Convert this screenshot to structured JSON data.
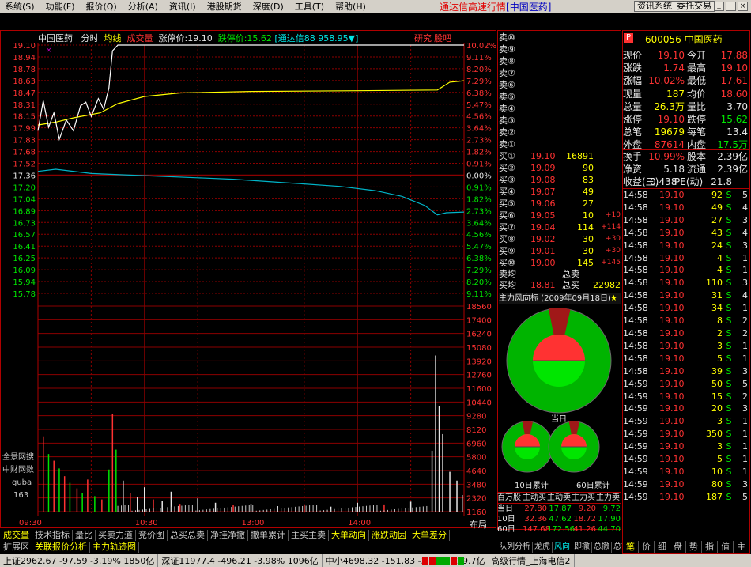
{
  "menu": [
    "系统(S)",
    "功能(F)",
    "报价(Q)",
    "分析(A)",
    "资讯(I)",
    "港股期货",
    "深度(D)",
    "工具(T)",
    "帮助(H)"
  ],
  "title": {
    "main": "通达信高速行情",
    "stock": "[中国医药]"
  },
  "right_buttons": [
    "资讯系统",
    "委托交易"
  ],
  "chart_header": {
    "name": "中国医药",
    "mode": "分时",
    "avg_label": "均线",
    "vol_label": "成交量",
    "limit_up": "涨停价:19.10",
    "limit_down": "跌停价:15.62",
    "tdx": "[通达信88 958.95▼]",
    "research": "研究",
    "guba": "股吧"
  },
  "side_labels": [
    "全景网搜",
    "中财网数",
    "guba",
    "163"
  ],
  "chart_data": {
    "type": "line",
    "price_ticks": [
      "19.10",
      "18.94",
      "18.78",
      "18.63",
      "18.47",
      "18.31",
      "18.15",
      "17.99",
      "17.83",
      "17.68",
      "17.52",
      "17.36",
      "17.20",
      "17.04",
      "16.89",
      "16.73",
      "16.57",
      "16.41",
      "16.25",
      "16.09",
      "15.94",
      "15.78"
    ],
    "pct_ticks": [
      "10.02%",
      "9.11%",
      "8.20%",
      "7.29%",
      "6.38%",
      "5.47%",
      "4.56%",
      "3.64%",
      "2.73%",
      "1.82%",
      "0.91%",
      "0.00%",
      "0.91%",
      "1.82%",
      "2.73%",
      "3.64%",
      "4.56%",
      "5.47%",
      "6.38%",
      "7.29%",
      "8.20%",
      "9.11%"
    ],
    "vol_ticks": [
      "18560",
      "17400",
      "16240",
      "15080",
      "13920",
      "12760",
      "11600",
      "10440",
      "9280",
      "8120",
      "6960",
      "5800",
      "4640",
      "3480",
      "2320",
      "1160"
    ],
    "time_labels": [
      "09:30",
      "10:30",
      "13:00",
      "14:00"
    ],
    "prev_close": 17.36,
    "ylim": [
      15.62,
      19.1
    ],
    "price": [
      {
        "t": 0,
        "v": 17.9
      },
      {
        "t": 3,
        "v": 18.32
      },
      {
        "t": 6,
        "v": 17.95
      },
      {
        "t": 9,
        "v": 18.15
      },
      {
        "t": 12,
        "v": 17.78
      },
      {
        "t": 16,
        "v": 18.05
      },
      {
        "t": 20,
        "v": 17.9
      },
      {
        "t": 24,
        "v": 18.25
      },
      {
        "t": 27,
        "v": 18.3
      },
      {
        "t": 30,
        "v": 18.1
      },
      {
        "t": 34,
        "v": 18.35
      },
      {
        "t": 37,
        "v": 18.2
      },
      {
        "t": 40,
        "v": 18.5
      },
      {
        "t": 42,
        "v": 19.02
      },
      {
        "t": 45,
        "v": 19.1
      },
      {
        "t": 240,
        "v": 19.1
      }
    ],
    "avg": [
      {
        "t": 0,
        "v": 17.98
      },
      {
        "t": 10,
        "v": 18.02
      },
      {
        "t": 20,
        "v": 18.08
      },
      {
        "t": 35,
        "v": 18.15
      },
      {
        "t": 45,
        "v": 18.28
      },
      {
        "t": 60,
        "v": 18.38
      },
      {
        "t": 80,
        "v": 18.43
      },
      {
        "t": 120,
        "v": 18.45
      },
      {
        "t": 180,
        "v": 18.46
      },
      {
        "t": 225,
        "v": 18.47
      },
      {
        "t": 232,
        "v": 18.58
      },
      {
        "t": 240,
        "v": 18.6
      }
    ],
    "index": [
      {
        "t": 0,
        "v": 17.33
      },
      {
        "t": 10,
        "v": 17.36
      },
      {
        "t": 30,
        "v": 17.3
      },
      {
        "t": 60,
        "v": 17.27
      },
      {
        "t": 90,
        "v": 17.24
      },
      {
        "t": 110,
        "v": 17.22
      },
      {
        "t": 140,
        "v": 17.17
      },
      {
        "t": 170,
        "v": 17.12
      },
      {
        "t": 190,
        "v": 17.06
      },
      {
        "t": 205,
        "v": 16.98
      },
      {
        "t": 218,
        "v": 16.85
      },
      {
        "t": 225,
        "v": 16.72
      },
      {
        "t": 230,
        "v": 16.75
      },
      {
        "t": 240,
        "v": 16.76
      }
    ],
    "volume": [
      {
        "t": 3,
        "v": 6800
      },
      {
        "t": 6,
        "v": 5200
      },
      {
        "t": 9,
        "v": 4600
      },
      {
        "t": 12,
        "v": 3900
      },
      {
        "t": 15,
        "v": 3200
      },
      {
        "t": 18,
        "v": 2600
      },
      {
        "t": 22,
        "v": 2100
      },
      {
        "t": 25,
        "v": 1700
      },
      {
        "t": 28,
        "v": 2900
      },
      {
        "t": 32,
        "v": 1400
      },
      {
        "t": 36,
        "v": 1100
      },
      {
        "t": 40,
        "v": 3800
      },
      {
        "t": 42,
        "v": 8800
      },
      {
        "t": 44,
        "v": 5600
      },
      {
        "t": 48,
        "v": 2800
      },
      {
        "t": 52,
        "v": 1700
      },
      {
        "t": 56,
        "v": 1300
      },
      {
        "t": 60,
        "v": 2200
      },
      {
        "t": 65,
        "v": 1100
      },
      {
        "t": 70,
        "v": 950
      },
      {
        "t": 75,
        "v": 1800
      },
      {
        "t": 80,
        "v": 700
      },
      {
        "t": 90,
        "v": 1200
      },
      {
        "t": 100,
        "v": 800
      },
      {
        "t": 110,
        "v": 600
      },
      {
        "t": 120,
        "v": 700
      },
      {
        "t": 135,
        "v": 500
      },
      {
        "t": 150,
        "v": 600
      },
      {
        "t": 165,
        "v": 450
      },
      {
        "t": 180,
        "v": 800
      },
      {
        "t": 195,
        "v": 650
      },
      {
        "t": 210,
        "v": 900
      },
      {
        "t": 222,
        "v": 5500
      },
      {
        "t": 224,
        "v": 14100
      },
      {
        "t": 226,
        "v": 9500
      },
      {
        "t": 228,
        "v": 7000
      },
      {
        "t": 232,
        "v": 3600
      },
      {
        "t": 236,
        "v": 2800
      },
      {
        "t": 239,
        "v": 1500
      }
    ]
  },
  "chart_footer": {
    "layout": "布局"
  },
  "sell_labels": [
    "卖⑩",
    "卖⑨",
    "卖⑧",
    "卖⑦",
    "卖⑥",
    "卖⑤",
    "卖④",
    "卖③",
    "卖②",
    "卖①"
  ],
  "buys": [
    {
      "label": "买①",
      "price": "19.10",
      "vol": "16891",
      "chg": ""
    },
    {
      "label": "买②",
      "price": "19.09",
      "vol": "90",
      "chg": ""
    },
    {
      "label": "买③",
      "price": "19.08",
      "vol": "83",
      "chg": ""
    },
    {
      "label": "买④",
      "price": "19.07",
      "vol": "49",
      "chg": ""
    },
    {
      "label": "买⑤",
      "price": "19.06",
      "vol": "27",
      "chg": ""
    },
    {
      "label": "买⑥",
      "price": "19.05",
      "vol": "10",
      "chg": "+10"
    },
    {
      "label": "买⑦",
      "price": "19.04",
      "vol": "114",
      "chg": "+114"
    },
    {
      "label": "买⑧",
      "price": "19.02",
      "vol": "30",
      "chg": "+30"
    },
    {
      "label": "买⑨",
      "price": "19.01",
      "vol": "30",
      "chg": "+30"
    },
    {
      "label": "买⑩",
      "price": "19.00",
      "vol": "145",
      "chg": "+145"
    }
  ],
  "avg_rows": [
    {
      "a": "卖均",
      "b": "",
      "c": "总卖",
      "d": ""
    },
    {
      "a": "买均",
      "b": "18.81",
      "c": "总买",
      "d": "22982"
    }
  ],
  "flow": {
    "title": "主力风向标 (2009年09月18日)",
    "today": "当日",
    "d10": "10日累计",
    "d60": "60日累计"
  },
  "flow_table": {
    "headers": [
      "百万股",
      "主动买",
      "主动卖",
      "主力买",
      "主力卖"
    ],
    "rows": [
      [
        "当日",
        "27.80",
        "17.87",
        "9.20",
        "9.72"
      ],
      [
        "10日",
        "32.36",
        "47.62",
        "18.72",
        "17.90"
      ],
      [
        "60日",
        "147.68",
        "172.56",
        "41.26",
        "44.70"
      ]
    ]
  },
  "left_panel_tabs": [
    "队列分析",
    "龙虎",
    "风向",
    "即撤",
    "总撤",
    "总答"
  ],
  "stock": {
    "code": "600056",
    "name": "中国医药"
  },
  "quote": [
    {
      "k1": "现价",
      "v1": "19.10",
      "k2": "今开",
      "v2": "17.88"
    },
    {
      "k1": "涨跌",
      "v1": "1.74",
      "k2": "最高",
      "v2": "19.10"
    },
    {
      "k1": "涨幅",
      "v1": "10.02%",
      "k2": "最低",
      "v2": "17.61"
    },
    {
      "k1": "现量",
      "v1": "187",
      "k2": "均价",
      "v2": "18.60"
    },
    {
      "k1": "总量",
      "v1": "26.3万",
      "k2": "量比",
      "v2": "3.70"
    },
    {
      "k1": "涨停",
      "v1": "19.10",
      "k2": "跌停",
      "v2": "15.62"
    },
    {
      "k1": "总笔",
      "v1": "19679",
      "k2": "每笔",
      "v2": "13.4"
    },
    {
      "k1": "外盘",
      "v1": "87614",
      "k2": "内盘",
      "v2": "17.5万"
    }
  ],
  "quote2": [
    {
      "k1": "换手",
      "v1": "10.99%",
      "k2": "股本",
      "v2": "2.39亿"
    },
    {
      "k1": "净资",
      "v1": "5.18",
      "k2": "流通",
      "v2": "2.39亿"
    },
    {
      "k1": "收益(三)",
      "v1": "0.438",
      "k2": "PE(动)",
      "v2": "21.8"
    }
  ],
  "ticks": [
    [
      "14:58",
      "19.10",
      "92",
      "S",
      "5"
    ],
    [
      "14:58",
      "19.10",
      "49",
      "S",
      "4"
    ],
    [
      "14:58",
      "19.10",
      "27",
      "S",
      "3"
    ],
    [
      "14:58",
      "19.10",
      "43",
      "S",
      "4"
    ],
    [
      "14:58",
      "19.10",
      "24",
      "S",
      "3"
    ],
    [
      "14:58",
      "19.10",
      "4",
      "S",
      "1"
    ],
    [
      "14:58",
      "19.10",
      "4",
      "S",
      "1"
    ],
    [
      "14:58",
      "19.10",
      "110",
      "S",
      "3"
    ],
    [
      "14:58",
      "19.10",
      "31",
      "S",
      "4"
    ],
    [
      "14:58",
      "19.10",
      "34",
      "S",
      "1"
    ],
    [
      "14:58",
      "19.10",
      "8",
      "S",
      "2"
    ],
    [
      "14:58",
      "19.10",
      "2",
      "S",
      "2"
    ],
    [
      "14:58",
      "19.10",
      "3",
      "S",
      "1"
    ],
    [
      "14:58",
      "19.10",
      "5",
      "S",
      "1"
    ],
    [
      "14:58",
      "19.10",
      "39",
      "S",
      "3"
    ],
    [
      "14:59",
      "19.10",
      "50",
      "S",
      "5"
    ],
    [
      "14:59",
      "19.10",
      "15",
      "S",
      "2"
    ],
    [
      "14:59",
      "19.10",
      "20",
      "S",
      "3"
    ],
    [
      "14:59",
      "19.10",
      "3",
      "S",
      "1"
    ],
    [
      "14:59",
      "19.10",
      "350",
      "S",
      "1"
    ],
    [
      "14:59",
      "19.10",
      "3",
      "S",
      "1"
    ],
    [
      "14:59",
      "19.10",
      "5",
      "S",
      "1"
    ],
    [
      "14:59",
      "19.10",
      "10",
      "S",
      "1"
    ],
    [
      "14:59",
      "19.10",
      "80",
      "S",
      "3"
    ],
    [
      "14:59",
      "19.10",
      "187",
      "S",
      "5"
    ]
  ],
  "right_tabs": [
    "笔",
    "价",
    "细",
    "盘",
    "势",
    "指",
    "值",
    "主"
  ],
  "bottom_tabs1": [
    "成交量",
    "技术指标",
    "量比",
    "买卖力道",
    "竞价图",
    "总买总卖",
    "净挂净撤",
    "撤单累计",
    "主买主卖",
    "大单动向",
    "涨跌动因",
    "大单差分"
  ],
  "bottom_tabs2": [
    "扩展区",
    "关联报价分析",
    "主力轨迹图"
  ],
  "status": [
    "上证2962.67 -97.59 -3.19% 1850亿",
    "深证11977.4 -496.21 -3.98% 1096亿",
    "中小4698.32 -151.83 -3.13% 329.7亿",
    "高级行情_上海电信2"
  ]
}
